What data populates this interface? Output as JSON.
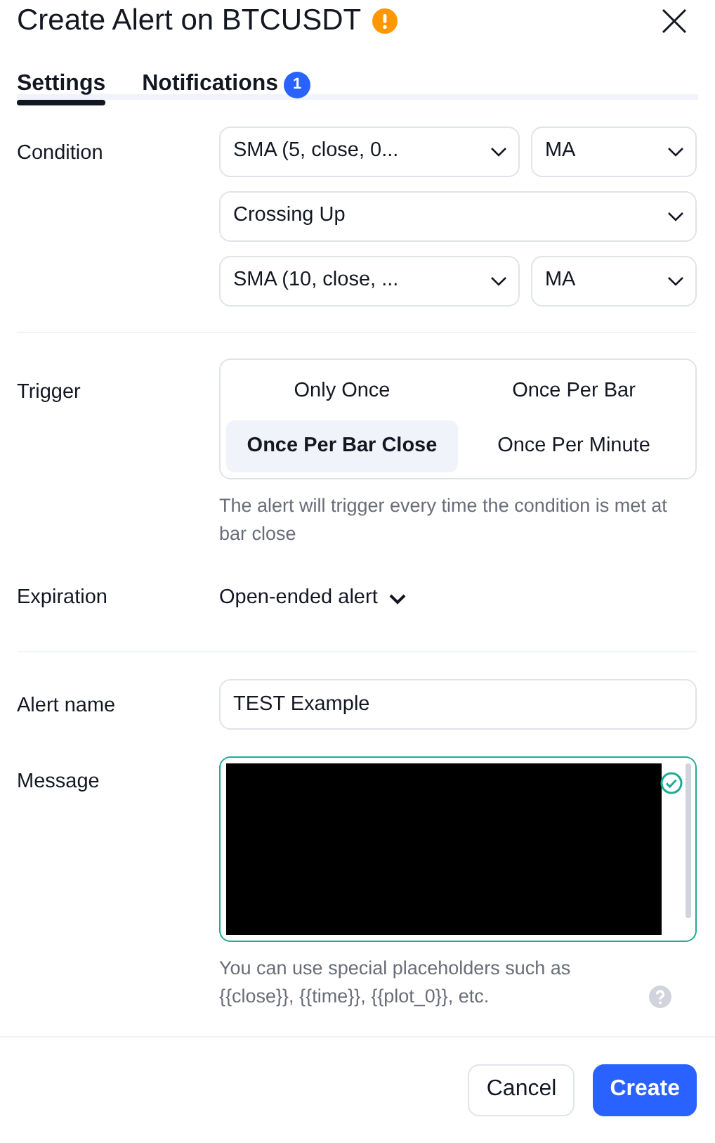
{
  "dialog": {
    "title": "Create Alert on BTCUSDT",
    "warning": true
  },
  "tabs": [
    {
      "label": "Settings",
      "selected": true
    },
    {
      "label": "Notifications",
      "selected": false,
      "badge": "1"
    }
  ],
  "condition": {
    "label": "Condition",
    "rows": [
      {
        "selects": [
          "SMA (5, close, 0...",
          "MA"
        ]
      },
      {
        "selects": [
          "Crossing Up"
        ]
      },
      {
        "selects": [
          "SMA (10, close, ...",
          "MA"
        ]
      }
    ]
  },
  "trigger": {
    "label": "Trigger",
    "options": [
      {
        "label": "Only Once",
        "selected": false
      },
      {
        "label": "Once Per Bar",
        "selected": false
      },
      {
        "label": "Once Per Bar Close",
        "selected": true
      },
      {
        "label": "Once Per Minute",
        "selected": false
      }
    ],
    "hint": "The alert will trigger every time the condition is met at bar close"
  },
  "expiration": {
    "label": "Expiration",
    "value": "Open-ended alert"
  },
  "alert_name": {
    "label": "Alert name",
    "value": "TEST Example"
  },
  "message": {
    "label": "Message",
    "redacted": true,
    "valid": true,
    "hint": "You can use special placeholders such as {{close}}, {{time}}, {{plot_0}}, etc."
  },
  "buttons": [
    {
      "label": "Cancel",
      "kind": "secondary"
    },
    {
      "label": "Create",
      "kind": "primary"
    }
  ]
}
